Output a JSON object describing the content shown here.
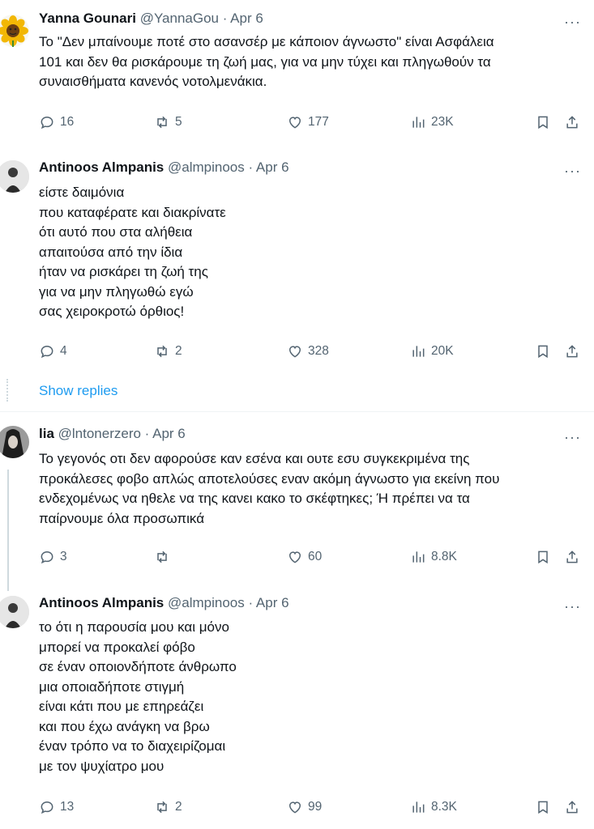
{
  "tweets": [
    {
      "name": "Yanna Gounari",
      "meta": "@YannaGou · Apr 6",
      "text": "Το \"Δεν μπαίνουμε ποτέ στο ασανσέρ με κάποιον άγνωστο\" είναι Ασφάλεια\n101 και δεν θα ρισκάρουμε τη ζωή μας, για να μην τύχει και πληγωθούν τα\nσυναισθήματα κανενός νοτολμενάκια.",
      "replies": "16",
      "retweets": "5",
      "likes": "177",
      "views": "23K"
    },
    {
      "name": "Antinoos Almpanis",
      "meta": "@almpinoos · Apr 6",
      "text": "είστε δαιμόνια\nπου καταφέρατε και διακρίνατε\nότι αυτό που στα αλήθεια\nαπαιτούσα από την ίδια\nήταν να ρισκάρει τη ζωή της\nγια να μην πληγωθώ εγώ\nσας χειροκροτώ όρθιος!",
      "replies": "4",
      "retweets": "2",
      "likes": "328",
      "views": "20K"
    },
    {
      "name": "lia",
      "meta": "@lntonerzero · Apr 6",
      "text": "Το γεγονός οτι δεν αφορούσε καν εσένα και ουτε εσυ συγκεκριμένα της\nπροκάλεσες φοβο απλώς αποτελούσες εναν ακόμη άγνωστο για εκείνη που\nενδεχομένως να ηθελε να της κανει κακο το σκέφτηκες; Ή πρέπει να τα\nπαίρνουμε όλα προσωπικά",
      "replies": "3",
      "retweets": "",
      "likes": "60",
      "views": "8.8K"
    },
    {
      "name": "Antinoos Almpanis",
      "meta": "@almpinoos · Apr 6",
      "text": "το ότι η παρουσία μου και μόνο\nμπορεί να προκαλεί φόβο\nσε έναν οποιονδήποτε άνθρωπο\nμια οποιαδήποτε στιγμή\nείναι κάτι που με επηρεάζει\nκαι που έχω ανάγκη να βρω\nέναν τρόπο να το διαχειρίζομαι\nμε τον ψυχίατρο μου",
      "replies": "13",
      "retweets": "2",
      "likes": "99",
      "views": "8.3K"
    }
  ],
  "show_replies": "Show replies",
  "more_label": "···",
  "colors": {
    "accent": "#1d9bf0",
    "secondary": "#536471",
    "text": "#0f1419"
  }
}
